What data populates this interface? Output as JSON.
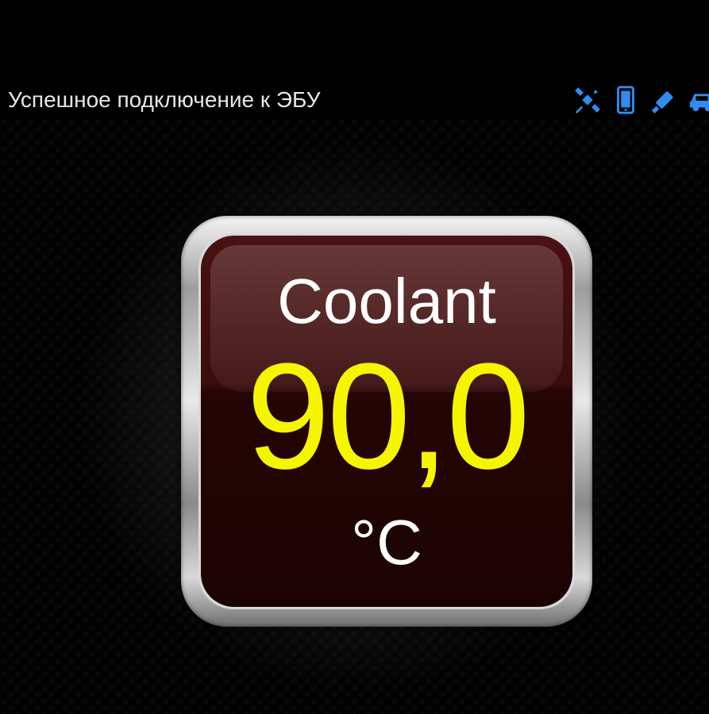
{
  "status_bar": {
    "connection_text": "Успешное подключение к ЭБУ",
    "icons": [
      "satellite-icon",
      "phone-icon",
      "usb-dongle-icon",
      "car-icon"
    ],
    "icon_color": "#2f8cf0"
  },
  "gauge": {
    "label": "Coolant",
    "value": "90,0",
    "unit": "°C",
    "value_color": "#f5f500",
    "face_color": "#2a0606"
  }
}
